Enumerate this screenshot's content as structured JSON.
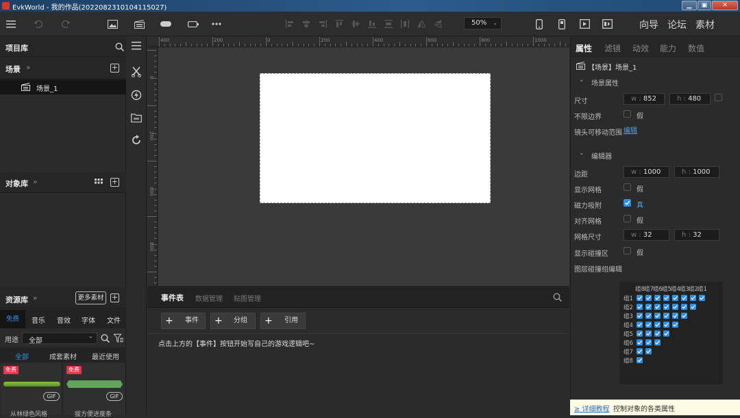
{
  "window": {
    "title": "EvkWorld - 我的作品(20220823101041150​27)"
  },
  "toolbar": {
    "zoom": "50%",
    "nav": [
      "向导",
      "论坛",
      "素材"
    ]
  },
  "left": {
    "project_lib": "项目库",
    "scene_header": "场景",
    "scene_items": [
      "场景_1"
    ],
    "object_lib": "对象库",
    "asset_lib": "资源库",
    "more_assets": "更多素材",
    "asset_tabs": [
      "免费素...",
      "音乐",
      "音效",
      "字体",
      "文件"
    ],
    "usage_label": "用途",
    "usage_value": "全部",
    "filter_tabs": [
      "全部",
      "成套素材",
      "最近使用"
    ],
    "cards": [
      {
        "badge": "免费",
        "gif": "GIF",
        "name": "从林绿色风格"
      },
      {
        "badge": "免费",
        "gif": "GIF",
        "name": "拔方便进度条"
      }
    ]
  },
  "ruler": {
    "top": [
      "400",
      "200",
      "0",
      "200",
      "400",
      "600",
      "800",
      "1000"
    ],
    "left": [
      "0",
      "200",
      "400",
      "600"
    ]
  },
  "events": {
    "tabs": [
      "事件表",
      "数据管理",
      "贴图管理"
    ],
    "buttons": [
      "事件",
      "分组",
      "引用"
    ],
    "hint": "点击上方的【事件】按钮开始写自己的游戏逻辑吧~"
  },
  "right": {
    "tabs": [
      "属性",
      "滤镜",
      "动效",
      "能力",
      "数值"
    ],
    "object_title": "【场景】场景_1",
    "scene_section": "场景属性",
    "size_label": "尺寸",
    "size_w": "852",
    "size_h": "480",
    "w_prefix": "w :",
    "h_prefix": "h :",
    "unbounded_label": "不限边界",
    "unbounded_value": "假",
    "camera_label": "镜头可移动范围",
    "camera_link": "编辑",
    "editor_section": "编辑器",
    "margin_label": "边距",
    "margin_w": "1000",
    "margin_h": "1000",
    "show_grid_label": "显示网格",
    "show_grid_value": "假",
    "snap_label": "磁力吸附",
    "snap_value": "真",
    "align_grid_label": "对齐网格",
    "align_grid_value": "假",
    "grid_size_label": "网格尺寸",
    "grid_w": "32",
    "grid_h": "32",
    "show_collision_label": "显示碰撞区",
    "show_collision_value": "假",
    "layer_collision_label": "图层碰撞组编辑",
    "group_cols": [
      "组8",
      "组7",
      "组6",
      "组5",
      "组4",
      "组3",
      "组2",
      "组1"
    ],
    "group_rows": [
      "组1",
      "组2",
      "组3",
      "组4",
      "组5",
      "组6",
      "组7",
      "组8"
    ],
    "tip_link": "≥ 详细教程",
    "tip_text": "控制对象的各类属性"
  },
  "colors": {
    "accent": "#2d8fe8",
    "badge": "#e8334a",
    "bar_green": "#6aa02a",
    "bar_teal": "#5fa55a"
  }
}
